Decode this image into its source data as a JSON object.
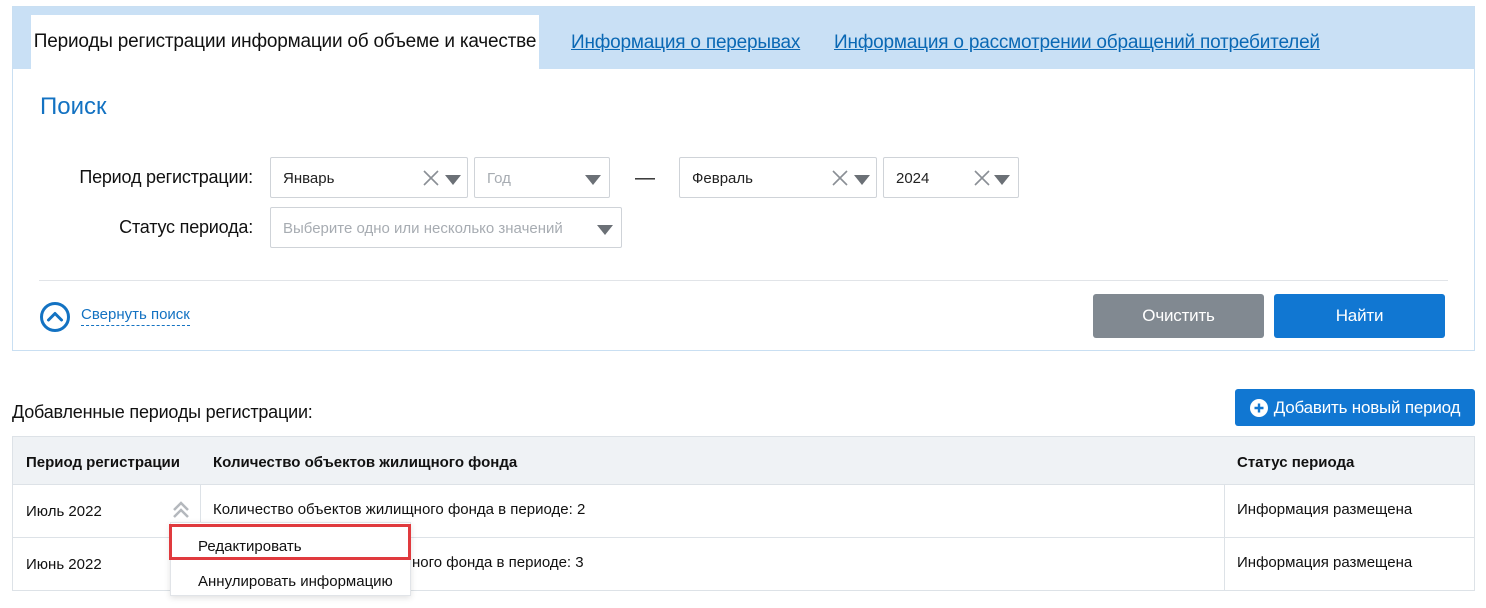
{
  "tabs": {
    "active": "Периоды регистрации информации об объеме и качестве",
    "breaks": "Информация о перерывах",
    "complaints": "Информация о рассмотрении обращений потребителей"
  },
  "search": {
    "title": "Поиск",
    "period_label": "Период регистрации:",
    "from_month": "Январь",
    "from_year_placeholder": "Год",
    "dash": "—",
    "to_month": "Февраль",
    "to_year": "2024",
    "status_label": "Статус периода:",
    "status_placeholder": "Выберите одно или несколько значений",
    "collapse": "Свернуть поиск",
    "clear_button": "Очистить",
    "find_button": "Найти"
  },
  "results": {
    "title": "Добавленные периоды регистрации:",
    "add_button": "Добавить новый период",
    "columns": [
      "Период регистрации",
      "Количество объектов жилищного фонда",
      "Статус периода"
    ],
    "rows": [
      {
        "period": "Июль 2022",
        "count": "Количество объектов жилищного фонда в периоде: 2",
        "status": "Информация размещена"
      },
      {
        "period": "Июнь 2022",
        "count_visible": "ного фонда в периоде: 3",
        "status": "Информация размещена"
      }
    ]
  },
  "context_menu": {
    "edit": "Редактировать",
    "annul": "Аннулировать информацию"
  },
  "colors": {
    "accent": "#1177d2",
    "tabbar": "#c9e0f5",
    "link": "#0a68b4",
    "highlight": "#e03a3e",
    "button_gray": "#818991"
  }
}
